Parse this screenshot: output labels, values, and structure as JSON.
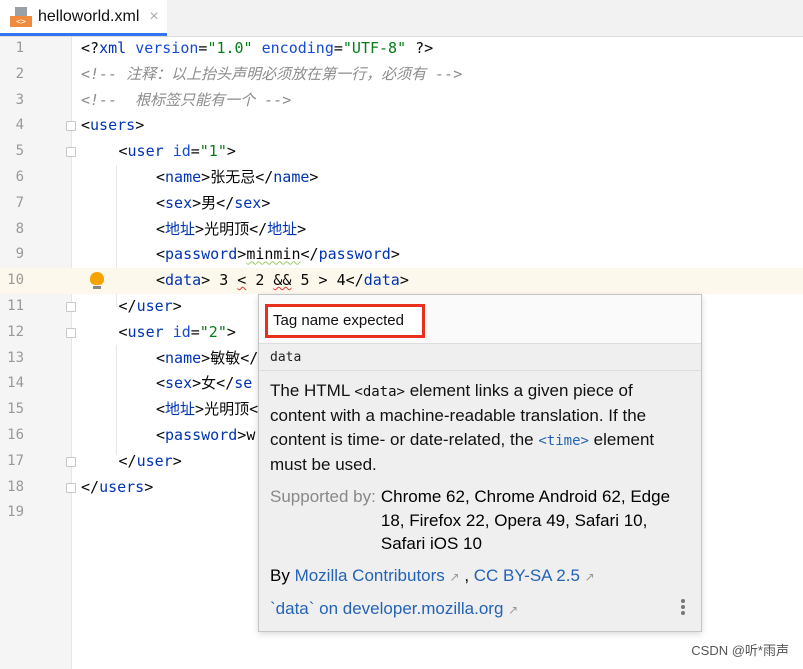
{
  "tab": {
    "filename": "helloworld.xml",
    "icon": "xml-file-icon",
    "file_icon_label": "<>",
    "close": "×"
  },
  "editor": {
    "current_line": 10,
    "lines": [
      {
        "n": "1",
        "indent": 0,
        "tokens": [
          [
            "p",
            "<?"
          ],
          [
            "t",
            "xml "
          ],
          [
            "a",
            "version"
          ],
          [
            "p",
            "="
          ],
          [
            "v",
            "\"1.0\""
          ],
          [
            "p",
            " "
          ],
          [
            "a",
            "encoding"
          ],
          [
            "p",
            "="
          ],
          [
            "v",
            "\"UTF-8\""
          ],
          [
            "p",
            " ?>"
          ]
        ]
      },
      {
        "n": "2",
        "indent": 0,
        "tokens": [
          [
            "c",
            "<!-- 注释：以上抬头声明必须放在第一行，必须有 -->"
          ]
        ]
      },
      {
        "n": "3",
        "indent": 0,
        "tokens": [
          [
            "c",
            "<!--  根标签只能有一个 -->"
          ]
        ]
      },
      {
        "n": "4",
        "indent": 0,
        "fold": true,
        "tokens": [
          [
            "p",
            "<"
          ],
          [
            "t",
            "users"
          ],
          [
            "p",
            ">"
          ]
        ]
      },
      {
        "n": "5",
        "indent": 1,
        "fold": true,
        "tokens": [
          [
            "p",
            "<"
          ],
          [
            "t",
            "user "
          ],
          [
            "a",
            "id"
          ],
          [
            "p",
            "="
          ],
          [
            "v",
            "\"1\""
          ],
          [
            "p",
            ">"
          ]
        ]
      },
      {
        "n": "6",
        "indent": 2,
        "tokens": [
          [
            "p",
            "<"
          ],
          [
            "t",
            "name"
          ],
          [
            "p",
            ">"
          ],
          [
            "x",
            "张无忌"
          ],
          [
            "p",
            "</"
          ],
          [
            "t",
            "name"
          ],
          [
            "p",
            ">"
          ]
        ]
      },
      {
        "n": "7",
        "indent": 2,
        "tokens": [
          [
            "p",
            "<"
          ],
          [
            "t",
            "sex"
          ],
          [
            "p",
            ">"
          ],
          [
            "x",
            "男"
          ],
          [
            "p",
            "</"
          ],
          [
            "t",
            "sex"
          ],
          [
            "p",
            ">"
          ]
        ]
      },
      {
        "n": "8",
        "indent": 2,
        "tokens": [
          [
            "p",
            "<"
          ],
          [
            "t",
            "地址"
          ],
          [
            "p",
            ">"
          ],
          [
            "x",
            "光明顶"
          ],
          [
            "p",
            "</"
          ],
          [
            "t",
            "地址"
          ],
          [
            "p",
            ">"
          ]
        ]
      },
      {
        "n": "9",
        "indent": 2,
        "tokens": [
          [
            "p",
            "<"
          ],
          [
            "t",
            "password"
          ],
          [
            "p",
            ">"
          ],
          [
            "xw",
            "minmin"
          ],
          [
            "p",
            "</"
          ],
          [
            "t",
            "password"
          ],
          [
            "p",
            ">"
          ]
        ]
      },
      {
        "n": "10",
        "indent": 2,
        "bulb": true,
        "tokens": [
          [
            "p",
            "<"
          ],
          [
            "t",
            "data"
          ],
          [
            "p",
            "> 3 "
          ],
          [
            "pe",
            "<"
          ],
          [
            "p",
            " 2 "
          ],
          [
            "pe",
            "&&"
          ],
          [
            "p",
            " 5 > 4</"
          ],
          [
            "t",
            "data"
          ],
          [
            "p",
            ">"
          ]
        ]
      },
      {
        "n": "11",
        "indent": 1,
        "fold": true,
        "tokens": [
          [
            "p",
            "</"
          ],
          [
            "t",
            "user"
          ],
          [
            "p",
            ">"
          ]
        ]
      },
      {
        "n": "12",
        "indent": 1,
        "fold": true,
        "tokens": [
          [
            "p",
            "<"
          ],
          [
            "t",
            "user "
          ],
          [
            "a",
            "id"
          ],
          [
            "p",
            "="
          ],
          [
            "v",
            "\"2\""
          ],
          [
            "p",
            ">"
          ]
        ]
      },
      {
        "n": "13",
        "indent": 2,
        "tokens": [
          [
            "p",
            "<"
          ],
          [
            "t",
            "name"
          ],
          [
            "p",
            ">"
          ],
          [
            "x",
            "敏敏"
          ],
          [
            "p",
            "</"
          ]
        ]
      },
      {
        "n": "14",
        "indent": 2,
        "tokens": [
          [
            "p",
            "<"
          ],
          [
            "t",
            "sex"
          ],
          [
            "p",
            ">"
          ],
          [
            "x",
            "女"
          ],
          [
            "p",
            "</"
          ],
          [
            "t",
            "se"
          ]
        ]
      },
      {
        "n": "15",
        "indent": 2,
        "tokens": [
          [
            "p",
            "<"
          ],
          [
            "t",
            "地址"
          ],
          [
            "p",
            ">"
          ],
          [
            "x",
            "光明顶"
          ],
          [
            "p",
            "<"
          ]
        ]
      },
      {
        "n": "16",
        "indent": 2,
        "tokens": [
          [
            "p",
            "<"
          ],
          [
            "t",
            "password"
          ],
          [
            "p",
            ">"
          ],
          [
            "x",
            "w"
          ]
        ]
      },
      {
        "n": "17",
        "indent": 1,
        "fold": true,
        "tokens": [
          [
            "p",
            "</"
          ],
          [
            "t",
            "user"
          ],
          [
            "p",
            ">"
          ]
        ]
      },
      {
        "n": "18",
        "indent": 0,
        "fold": true,
        "tokens": [
          [
            "p",
            "</"
          ],
          [
            "t",
            "users"
          ],
          [
            "p",
            ">"
          ]
        ]
      },
      {
        "n": "19",
        "indent": 0,
        "tokens": []
      }
    ]
  },
  "popup": {
    "error": "Tag name expected",
    "element": "data",
    "desc_1": "The HTML ",
    "desc_code": "<data>",
    "desc_2": " element links a given piece of content with a machine-readable translation. If the content is time- or date-related, the ",
    "desc_link": "<time>",
    "desc_3": " element must be used.",
    "supported_label": "Supported by:",
    "supported_value": "Chrome 62, Chrome Android 62, Edge 18, Firefox 22, Opera 49, Safari 10, Safari iOS 10",
    "by": "By ",
    "author_link": "Mozilla Contributors",
    "sep": " , ",
    "license_link": "CC BY-SA 2.5",
    "mdn_link": "`data` on developer.mozilla.org",
    "external_arrow": "↗"
  },
  "watermark": "CSDN @听*雨声",
  "colors": {
    "accent": "#3574f0",
    "error_box": "#e8301c",
    "link": "#2463b6",
    "tag": "#0033b3",
    "string": "#067d17",
    "comment": "#8c8c8c"
  }
}
